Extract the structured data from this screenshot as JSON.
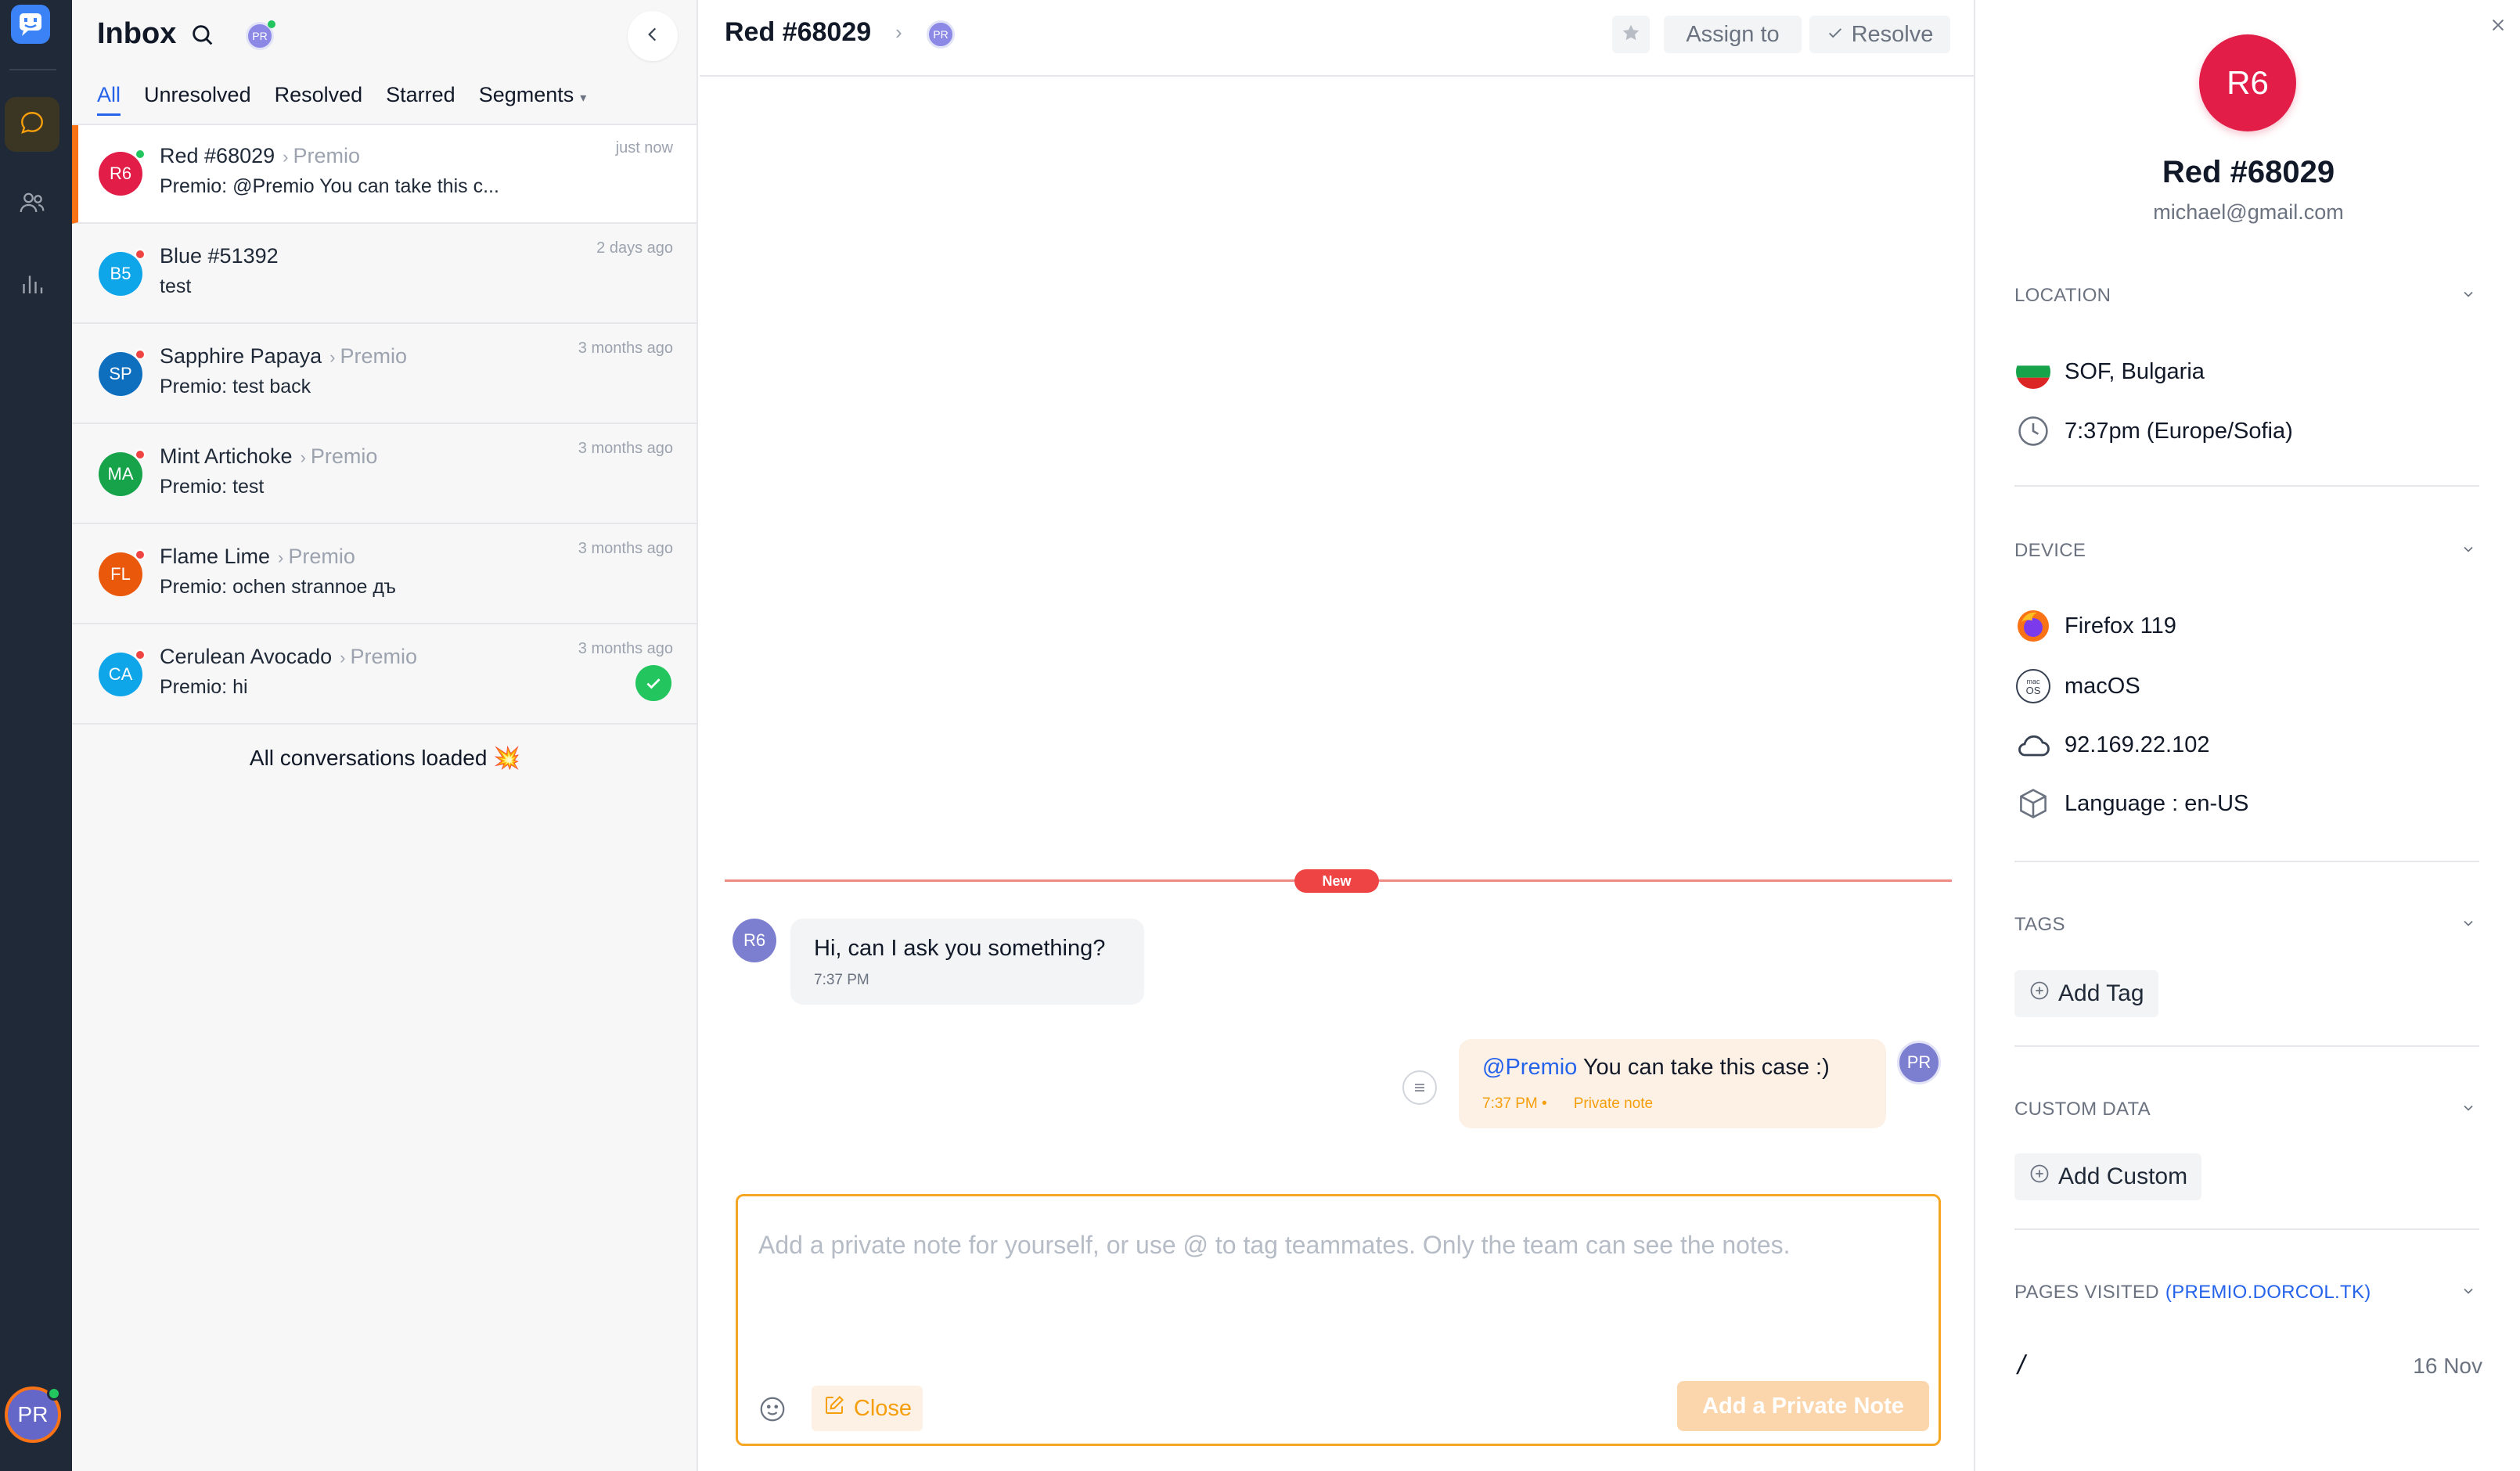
{
  "colors": {
    "accent": "#2563eb",
    "rail_bg": "#1f2937",
    "active_conv_border": "#f97316",
    "new_badge": "#ef4444",
    "private_note": "#f59e0b",
    "composer_border": "#f5a623"
  },
  "rail": {
    "logo_icon": "app-logo-icon",
    "items": [
      {
        "icon": "chat-bubble-icon",
        "active": true
      },
      {
        "icon": "users-icon",
        "active": false
      },
      {
        "icon": "bar-chart-icon",
        "active": false
      }
    ],
    "user_initials": "PR"
  },
  "inbox": {
    "title": "Inbox",
    "search_icon": "search-icon",
    "agent_initials": "PR",
    "tabs": [
      "All",
      "Unresolved",
      "Resolved",
      "Starred",
      "Segments"
    ],
    "active_tab": "All",
    "conversations": [
      {
        "initials": "R6",
        "name": "Red #68029",
        "team": "Premio",
        "preview": "Premio: @Premio You can take this c...",
        "time": "just now",
        "avatar_color": "#e11d48",
        "dot_color": "#22c55e",
        "active": true,
        "resolved": false
      },
      {
        "initials": "B5",
        "name": "Blue #51392",
        "team": "",
        "preview": "test",
        "time": "2 days ago",
        "avatar_color": "#0ea5e9",
        "dot_color": "#ef4444",
        "active": false,
        "resolved": false
      },
      {
        "initials": "SP",
        "name": "Sapphire Papaya",
        "team": "Premio",
        "preview": "Premio: test back",
        "time": "3 months ago",
        "avatar_color": "#0f6fbf",
        "dot_color": "#ef4444",
        "active": false,
        "resolved": false
      },
      {
        "initials": "MA",
        "name": "Mint Artichoke",
        "team": "Premio",
        "preview": "Premio: test",
        "time": "3 months ago",
        "avatar_color": "#16a34a",
        "dot_color": "#ef4444",
        "active": false,
        "resolved": false
      },
      {
        "initials": "FL",
        "name": "Flame Lime",
        "team": "Premio",
        "preview": "Premio: ochen strannoe дъ",
        "time": "3 months ago",
        "avatar_color": "#ea580c",
        "dot_color": "#ef4444",
        "active": false,
        "resolved": false
      },
      {
        "initials": "CA",
        "name": "Cerulean Avocado",
        "team": "Premio",
        "preview": "Premio: hi",
        "time": "3 months ago",
        "avatar_color": "#0ea5e9",
        "dot_color": "#ef4444",
        "active": false,
        "resolved": true
      }
    ],
    "loaded_text": "All conversations loaded 💥"
  },
  "chat": {
    "title": "Red #68029",
    "agent_initials": "PR",
    "assign_label": "Assign to",
    "resolve_label": "Resolve",
    "new_label": "New",
    "messages": [
      {
        "initials": "R6",
        "text": "Hi, can I ask you something?",
        "time": "7:37 PM"
      },
      {
        "initials": "PR",
        "mention": "@Premio",
        "text": " You can take this case :)",
        "time": "7:37 PM •",
        "note_label": "Private note"
      }
    ],
    "composer": {
      "placeholder": "Add a private note for yourself, or use @ to tag teammates. Only the team can see the notes.",
      "value": "",
      "close_label": "Close",
      "submit_label": "Add a Private Note"
    }
  },
  "profile": {
    "initials": "R6",
    "name": "Red #68029",
    "email": "michael@gmail.com",
    "location": {
      "title": "LOCATION",
      "city": "SOF, Bulgaria",
      "local_time": "7:37pm (Europe/Sofia)"
    },
    "device": {
      "title": "DEVICE",
      "browser": "Firefox 119",
      "os": "macOS",
      "ip": "92.169.22.102",
      "language": "Language : en-US"
    },
    "tags": {
      "title": "TAGS",
      "add_label": "Add Tag"
    },
    "custom_data": {
      "title": "CUSTOM DATA",
      "add_label": "Add Custom"
    },
    "pages_visited": {
      "title": "PAGES VISITED",
      "domain": "(PREMIO.DORCOL.TK)",
      "pages": [
        {
          "path": "/",
          "date": "16 Nov"
        }
      ]
    }
  }
}
